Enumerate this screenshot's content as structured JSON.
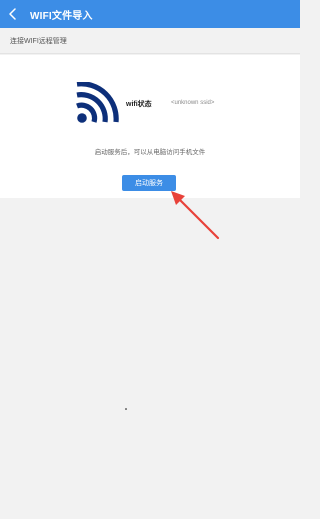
{
  "header": {
    "back_icon": "chevron-left-icon",
    "title": "WIFI文件导入",
    "color": "#3c8de6"
  },
  "subheader": {
    "text": "连接WIFI远程管理"
  },
  "wifi": {
    "icon": "wifi-signal-icon",
    "icon_color": "#0d2f7a",
    "status_label": "wifi状态",
    "ssid": "<unknown ssid>"
  },
  "hint": "启动服务后，可以从电脑访问手机文件",
  "start_button": {
    "label": "启动服务"
  },
  "annotation": {
    "arrow_color": "#e8423a"
  }
}
